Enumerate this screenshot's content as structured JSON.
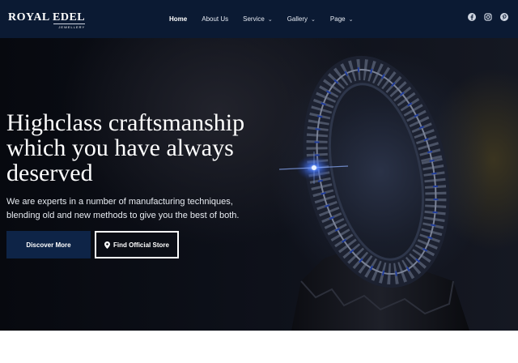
{
  "brand": {
    "name": "Royal Edel",
    "tagline": "JEWELLERY"
  },
  "nav": {
    "items": [
      {
        "label": "Home",
        "active": true,
        "dropdown": false
      },
      {
        "label": "About Us",
        "active": false,
        "dropdown": false
      },
      {
        "label": "Service",
        "active": false,
        "dropdown": true
      },
      {
        "label": "Gallery",
        "active": false,
        "dropdown": true
      },
      {
        "label": "Page",
        "active": false,
        "dropdown": true
      }
    ],
    "socials": [
      "facebook-icon",
      "instagram-icon",
      "pinterest-icon"
    ]
  },
  "hero": {
    "headline": "Highclass craftsmanship which you have always deserved",
    "subtext": "We are experts in a number of manufacturing techniques, blending old and new methods to give you the best of both.",
    "primary_button": "Discover More",
    "secondary_button": "Find Official Store"
  },
  "colors": {
    "navbar": "#0b1a33",
    "primary_button": "#0e2447",
    "accent_sapphire": "#3c6bff"
  }
}
